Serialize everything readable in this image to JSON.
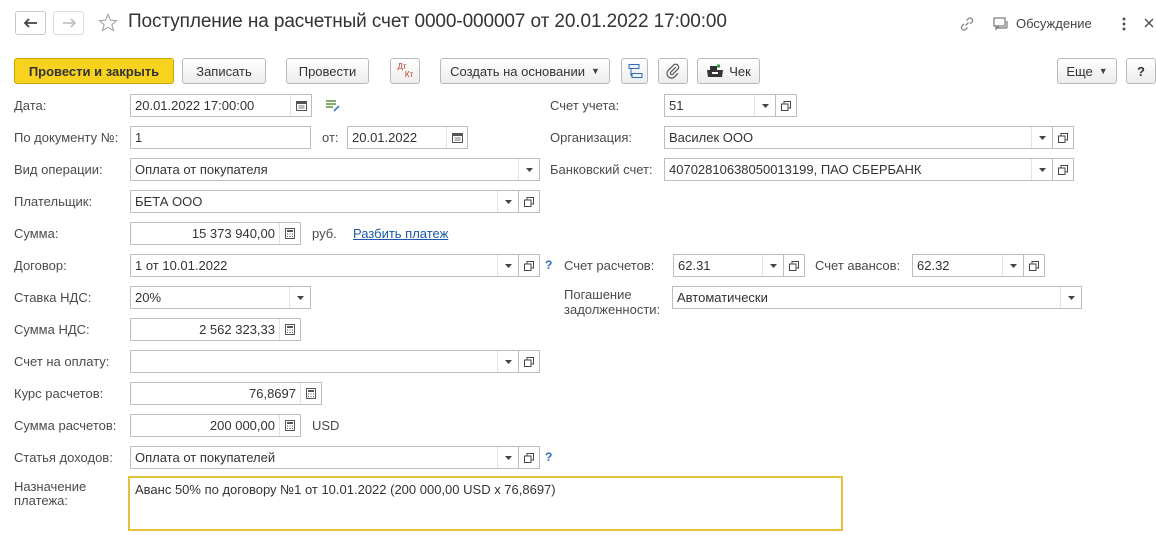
{
  "window": {
    "title": "Поступление на расчетный счет 0000-000007 от 20.01.2022 17:00:00",
    "discussion_label": "Обсуждение"
  },
  "toolbar": {
    "post_close": "Провести и закрыть",
    "save": "Записать",
    "post": "Провести",
    "dtkt_top": "Дт",
    "dtkt_bottom": "Кт",
    "create_based": "Создать на основании",
    "receipt": "Чек",
    "more": "Еще",
    "help": "?"
  },
  "form": {
    "date_label": "Дата:",
    "date_value": "20.01.2022 17:00:00",
    "doc_label": "По документу №:",
    "doc_value": "1",
    "from_label": "от:",
    "from_value": "20.01.2022",
    "op_label": "Вид операции:",
    "op_value": "Оплата от покупателя",
    "payer_label": "Плательщик:",
    "payer_value": "БЕТА ООО",
    "sum_label": "Сумма:",
    "sum_value": "15 373 940,00",
    "currency": "руб.",
    "split_link": "Разбить платеж",
    "contract_label": "Договор:",
    "contract_value": "1 от 10.01.2022",
    "vat_rate_label": "Ставка НДС:",
    "vat_rate_value": "20%",
    "vat_sum_label": "Сумма НДС:",
    "vat_sum_value": "2 562 323,33",
    "invoice_label": "Счет на оплату:",
    "invoice_value": "",
    "rate_label": "Курс расчетов:",
    "rate_value": "76,8697",
    "settle_label": "Сумма расчетов:",
    "settle_value": "200 000,00",
    "settle_currency": "USD",
    "income_label": "Статья доходов:",
    "income_value": "Оплата от покупателей",
    "purpose_label_1": "Назначение",
    "purpose_label_2": "платежа:",
    "purpose_value": "Аванс 50% по договору №1 от 10.01.2022 (200 000,00 USD x 76,8697)",
    "account_label": "Счет учета:",
    "account_value": "51",
    "org_label": "Организация:",
    "org_value": "Василек ООО",
    "bank_label": "Банковский счет:",
    "bank_value": "40702810638050013199, ПАО СБЕРБАНК",
    "calc_acc_label": "Счет расчетов:",
    "calc_acc_value": "62.31",
    "adv_acc_label": "Счет авансов:",
    "adv_acc_value": "62.32",
    "debt_label_1": "Погашение",
    "debt_label_2": "задолженности:",
    "debt_value": "Автоматически",
    "help_mark": "?"
  }
}
